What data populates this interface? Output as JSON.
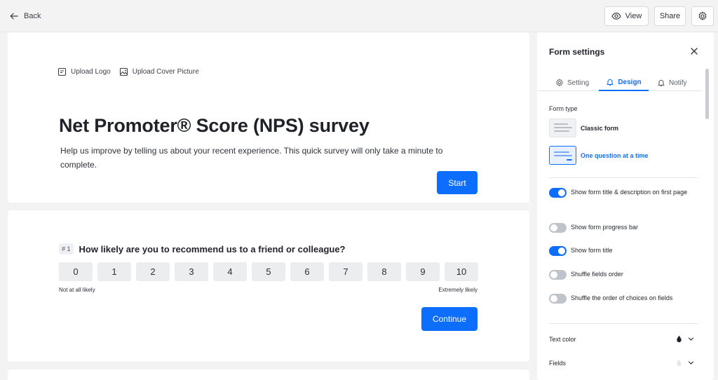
{
  "topbar": {
    "back_label": "Back",
    "view_label": "View",
    "share_label": "Share"
  },
  "form": {
    "upload_logo": "Upload Logo",
    "upload_cover": "Upload Cover Picture",
    "title": "Net Promoter® Score (NPS) survey",
    "description": "Help us improve by telling us about your recent experience. This quick survey will only take a minute to complete.",
    "start_label": "Start"
  },
  "question": {
    "number": "# 1",
    "text": "How likely are you to recommend us to a friend or colleague?",
    "scale": [
      "0",
      "1",
      "2",
      "3",
      "4",
      "5",
      "6",
      "7",
      "8",
      "9",
      "10"
    ],
    "low_label": "Not at all likely",
    "high_label": "Extremely likely",
    "continue_label": "Continue"
  },
  "settings": {
    "title": "Form settings",
    "tabs": {
      "setting": "Setting",
      "design": "Design",
      "notify": "Notify"
    },
    "form_type_label": "Form type",
    "form_types": {
      "classic": "Classic form",
      "one_question": "One question at a time"
    },
    "toggles": {
      "show_title_desc": {
        "label": "Show form title & description on first page",
        "on": true
      },
      "show_progress": {
        "label": "Show form progress bar",
        "on": false
      },
      "show_title": {
        "label": "Show form title",
        "on": true
      },
      "shuffle_fields": {
        "label": "Shuffle fields order",
        "on": false
      },
      "shuffle_choices": {
        "label": "Shuffle the order of choices on fields",
        "on": false
      }
    },
    "text_color_label": "Text color",
    "fields_label": "Fields",
    "colors": {
      "accent": "#0d6efd",
      "text_color": "#1f2329",
      "fields_color": "#e6e7ea"
    }
  }
}
